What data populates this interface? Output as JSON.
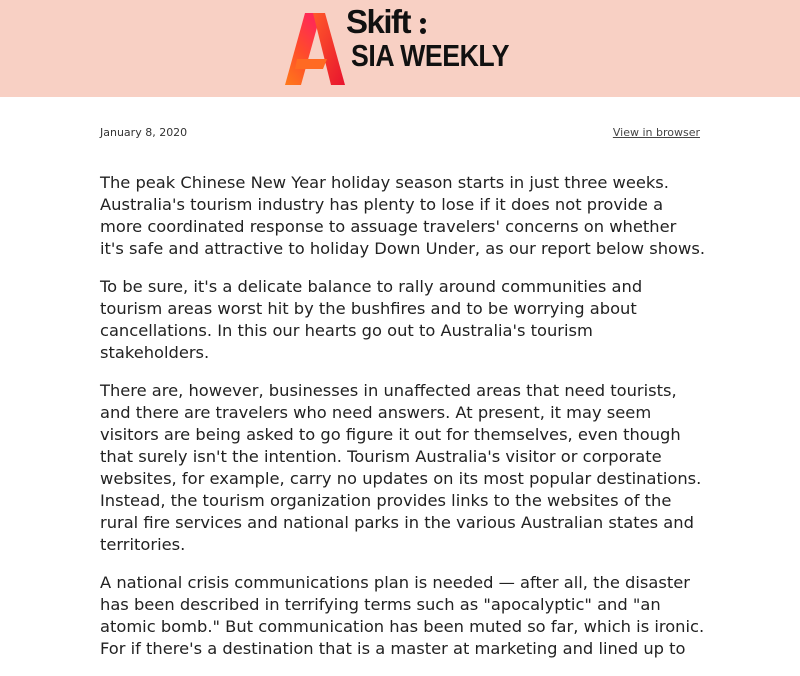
{
  "header": {
    "logo_top": "Skift",
    "logo_bottom": "SIA WEEKLY",
    "logo_alt": "Skift Asia Weekly",
    "background_color": "#f8d0c4",
    "logo_mark_icon": "skift-a-logo-icon"
  },
  "meta": {
    "date": "January 8, 2020",
    "view_in_browser_label": "View in browser"
  },
  "article": {
    "paragraphs": [
      "The peak Chinese New Year holiday season starts in just three weeks. Australia's tourism industry has plenty to lose if it does not provide a more coordinated response to assuage travelers' concerns on whether it's safe and attractive to holiday Down Under, as our report below shows.",
      "To be sure, it's a delicate balance to rally around communities and tourism areas worst hit by the bushfires and to be worrying about cancellations. In this our hearts go out to Australia's tourism stakeholders.",
      "There are, however, businesses in unaffected areas that need tourists, and there are travelers who need answers. At present, it may seem visitors are being asked to go figure it out for themselves, even though that surely isn't the intention. Tourism Australia's visitor or corporate websites, for example, carry no updates on its most popular destinations. Instead, the tourism organization provides links to the websites of the rural fire services and national parks in the various Australian states and territories.",
      "A national crisis communications plan is needed — after all, the disaster has been described in terrifying terms such as \"apocalyptic\" and \"an atomic bomb.\" But communication has been muted so far, which is ironic. For if there's a destination that is a master at marketing and lined up to"
    ]
  }
}
